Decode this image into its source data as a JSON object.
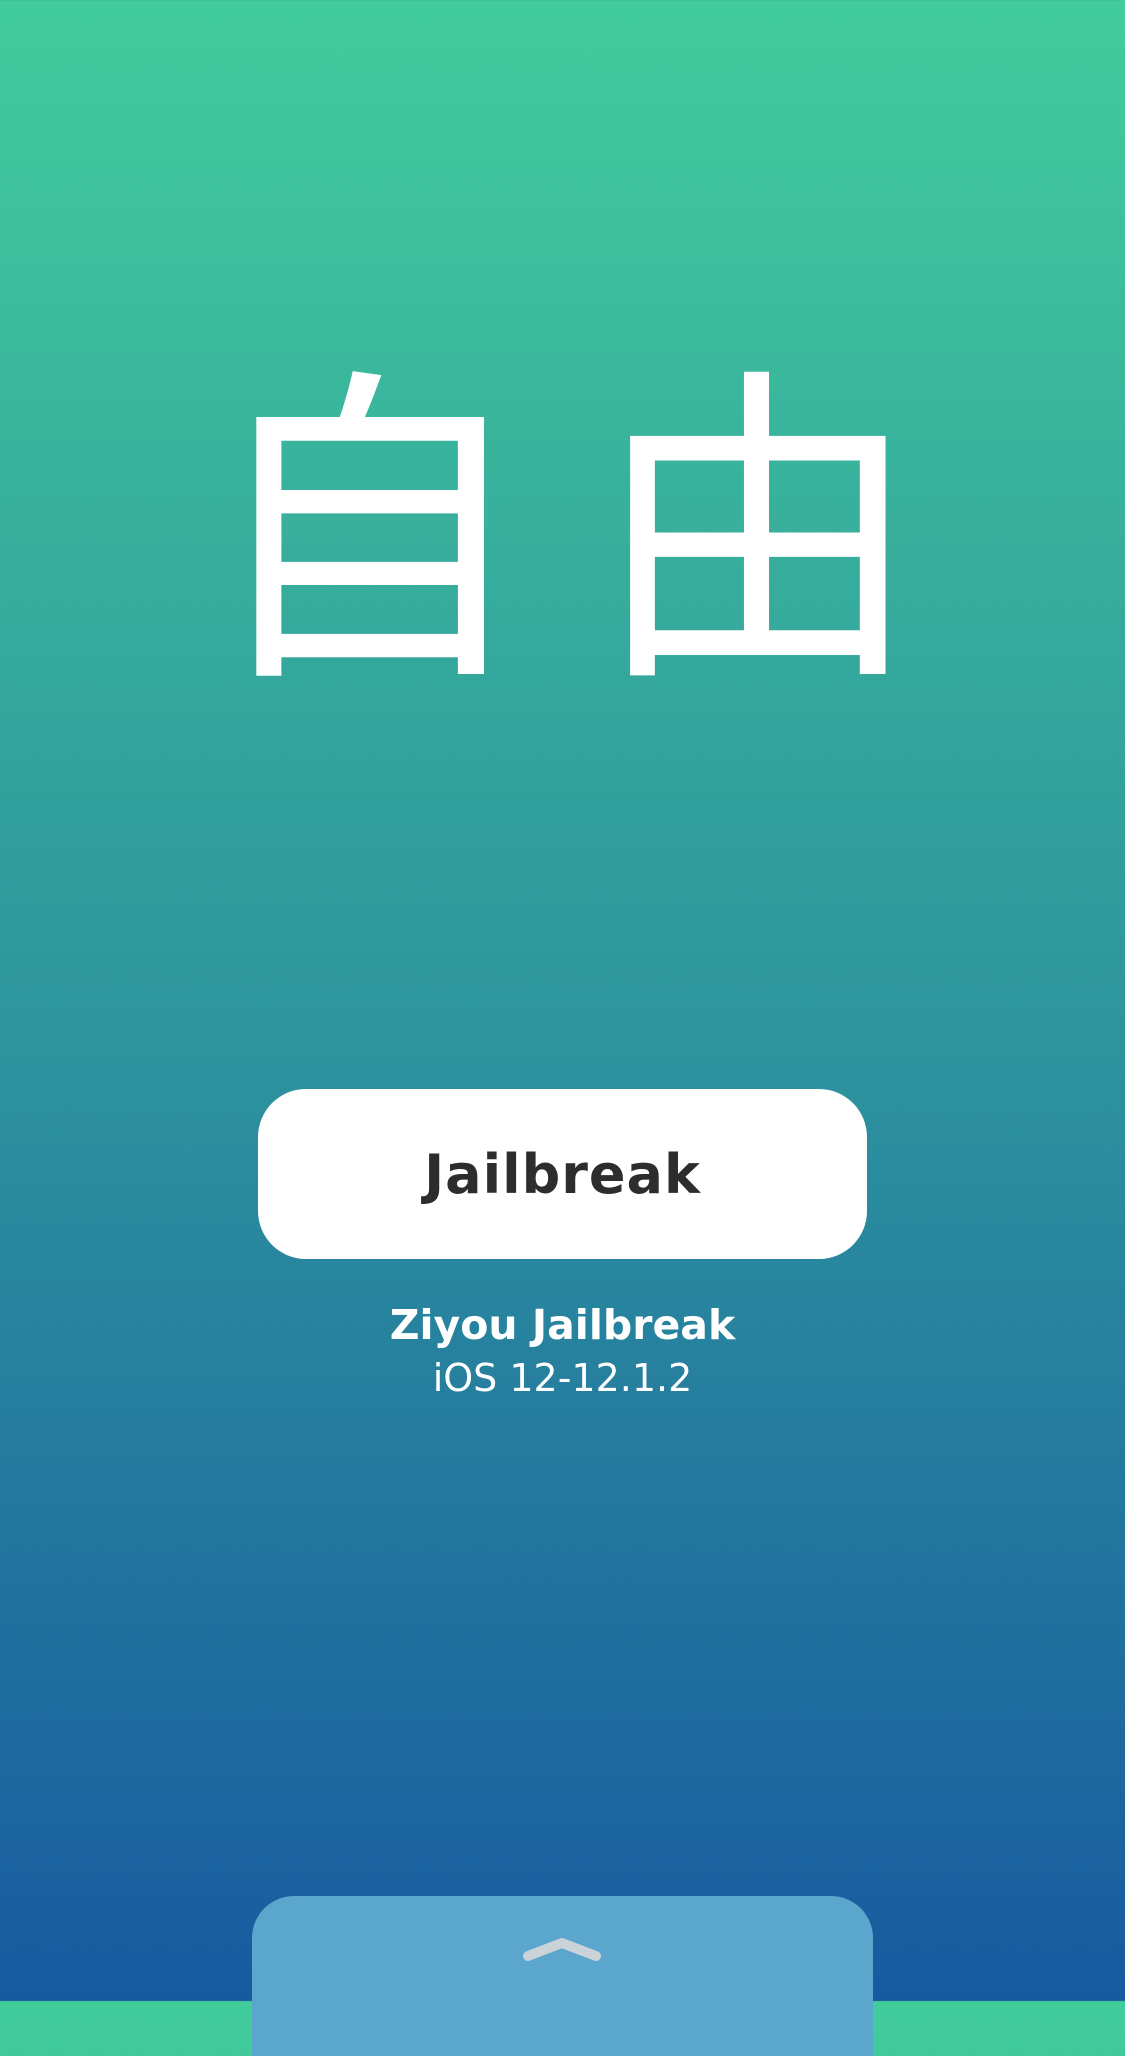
{
  "logo": {
    "text": "自由"
  },
  "jailbreak_button": {
    "label": "Jailbreak"
  },
  "app": {
    "title": "Ziyou Jailbreak",
    "version": "iOS 12-12.1.2"
  },
  "drawer": {
    "icon": "chevron-up-icon"
  },
  "colors": {
    "gradient_top": "#42cc9c",
    "gradient_bottom": "#185aa0",
    "button_bg": "#ffffff",
    "button_text": "#2d2d2d",
    "drawer_bg": "#5ba6cd"
  }
}
